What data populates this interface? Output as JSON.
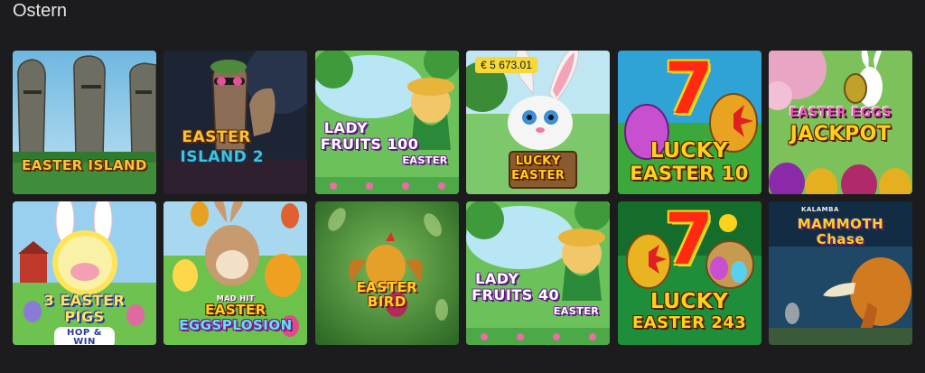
{
  "section": {
    "title": "Ostern"
  },
  "games": [
    {
      "id": "easter-island",
      "title_lines": [
        "EASTER ISLAND"
      ]
    },
    {
      "id": "easter-island-2",
      "title_lines": [
        "EASTER",
        "ISLAND 2"
      ]
    },
    {
      "id": "lady-fruits-100",
      "title_lines": [
        "LADY",
        "FRUITS 100",
        "EASTER"
      ]
    },
    {
      "id": "lucky-easter",
      "title_lines": [
        "LUCKY",
        "EASTER"
      ],
      "jackpot": "€ 5 673.01"
    },
    {
      "id": "lucky-easter-10",
      "title_lines": [
        "7",
        "LUCKY",
        "EASTER 10"
      ]
    },
    {
      "id": "easter-eggs-jackpot",
      "title_lines": [
        "EASTER EGGS",
        "JACKPOT"
      ]
    },
    {
      "id": "3-easter-pigs",
      "title_lines": [
        "3 EASTER",
        "PIGS",
        "HOP & WIN"
      ]
    },
    {
      "id": "eggsplosion",
      "title_lines": [
        "MAD HIT",
        "EASTER",
        "EGGSPLOSION"
      ]
    },
    {
      "id": "easter-bird",
      "title_lines": [
        "EASTER",
        "BIRD"
      ]
    },
    {
      "id": "lady-fruits-40",
      "title_lines": [
        "LADY",
        "FRUITS 40",
        "EASTER"
      ]
    },
    {
      "id": "lucky-easter-243",
      "title_lines": [
        "7",
        "LUCKY",
        "EASTER 243"
      ]
    },
    {
      "id": "mammoth-chase",
      "title_lines": [
        "KALAMBA",
        "MAMMOTH",
        "Chase"
      ]
    }
  ]
}
